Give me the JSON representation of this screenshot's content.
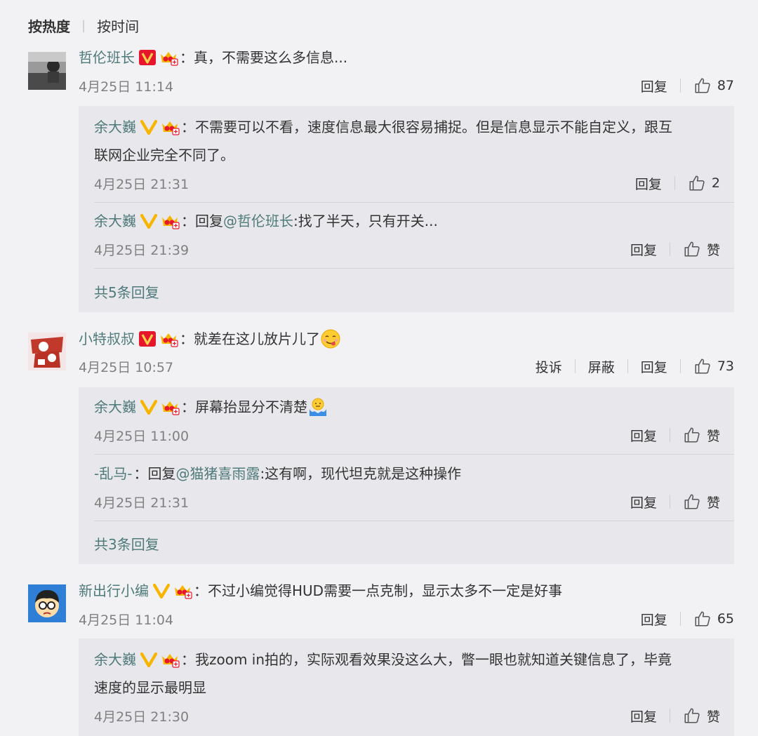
{
  "sort": {
    "active": "按热度",
    "other": "按时间"
  },
  "comments": [
    {
      "user": "哲伦班长",
      "text": "真，不需要这么多信息...",
      "time": "4月25日 11:14",
      "reply": "回复",
      "likes": "87",
      "replies": [
        {
          "user": "余大巍",
          "text": "不需要可以不看，速度信息最大很容易捕捉。但是信息显示不能自定义，跟互",
          "text2": "联网企业完全不同了。",
          "time": "4月25日 21:31",
          "reply": "回复",
          "likes": "2"
        },
        {
          "user": "余大巍",
          "prefix": "回复",
          "mention": "@哲伦班长",
          "text": ":找了半天，只有开关...",
          "time": "4月25日 21:39",
          "reply": "回复",
          "likes": "赞"
        }
      ],
      "more": "共5条回复"
    },
    {
      "user": "小特叔叔",
      "text": "就差在这儿放片儿了",
      "time": "4月25日 10:57",
      "complain": "投诉",
      "block": "屏蔽",
      "reply": "回复",
      "likes": "73",
      "replies": [
        {
          "user": "余大巍",
          "text": "屏幕抬显分不清楚",
          "time": "4月25日 11:00",
          "reply": "回复",
          "likes": "赞"
        },
        {
          "user": "-乱马-",
          "prefix": "回复",
          "mention": "@猫猪喜雨露",
          "text": ":这有啊，现代坦克就是这种操作",
          "time": "4月25日 21:31",
          "reply": "回复",
          "likes": "赞"
        }
      ],
      "more": "共3条回复"
    },
    {
      "user": "新出行小编",
      "text": "不过小编觉得HUD需要一点克制，显示太多不一定是好事",
      "time": "4月25日 11:04",
      "reply": "回复",
      "likes": "65",
      "replies": [
        {
          "user": "余大巍",
          "text": "我zoom in拍的，实际观看效果没这么大，瞥一眼也就知道关键信息了，毕竟",
          "text2": "速度的显示最明显",
          "time": "4月25日 21:30",
          "reply": "回复",
          "likes": "赞"
        }
      ]
    }
  ],
  "colon": "：",
  "colors": {
    "username": "#4f7a7a",
    "verified_red": "#e6162d",
    "verified_gold": "#f7b500",
    "reply_bg": "#e8e8ec"
  }
}
